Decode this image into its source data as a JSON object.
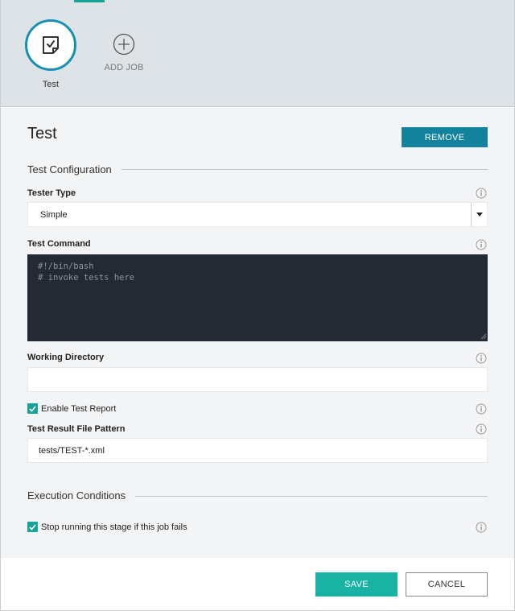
{
  "jobs": [
    {
      "label": "Test",
      "icon": "test-checklist-icon",
      "active": true
    },
    {
      "label": "ADD JOB",
      "icon": "plus-circle-icon"
    }
  ],
  "stage_job": {
    "title": "Test",
    "remove_label": "REMOVE"
  },
  "sections": {
    "test_config": "Test Configuration",
    "execution": "Execution Conditions"
  },
  "fields": {
    "tester_type": {
      "label": "Tester Type",
      "value": "Simple"
    },
    "test_command": {
      "label": "Test Command",
      "value": "#!/bin/bash\n# invoke tests here"
    },
    "working_directory": {
      "label": "Working Directory",
      "value": ""
    },
    "enable_report": {
      "label": "Enable Test Report",
      "checked": true
    },
    "result_pattern": {
      "label": "Test Result File Pattern",
      "value": "tests/TEST-*.xml"
    },
    "stop_on_fail": {
      "label": "Stop running this stage if this job fails",
      "checked": true
    }
  },
  "footer": {
    "save_label": "SAVE",
    "cancel_label": "CANCEL"
  },
  "colors": {
    "accent_teal": "#19a398",
    "remove_blue": "#12829d",
    "active_ring": "#1a8fb5",
    "code_bg": "#232a33"
  }
}
